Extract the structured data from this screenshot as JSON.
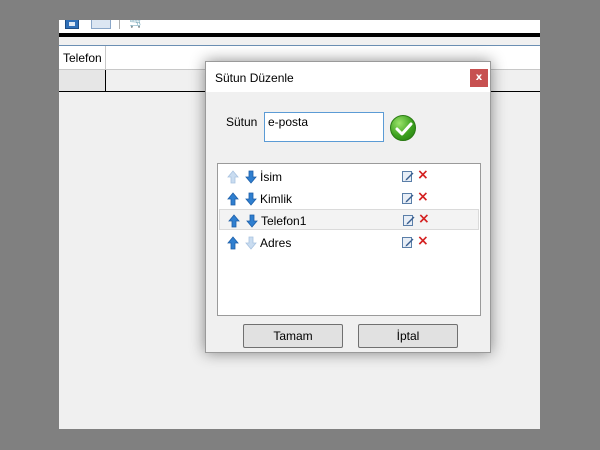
{
  "app": {
    "grid": {
      "columns": [
        "Telefon"
      ]
    }
  },
  "dialog": {
    "title": "Sütun Düzenle",
    "close_label": "x",
    "field_label": "Sütun",
    "field_value": "e-posta",
    "columns": [
      {
        "label": "İsim",
        "up_enabled": false,
        "down_enabled": true
      },
      {
        "label": "Kimlik",
        "up_enabled": true,
        "down_enabled": true
      },
      {
        "label": "Telefon1",
        "up_enabled": true,
        "down_enabled": true,
        "selected": true
      },
      {
        "label": "Adres",
        "up_enabled": true,
        "down_enabled": false
      }
    ],
    "buttons": {
      "ok": "Tamam",
      "cancel": "İptal"
    }
  },
  "colors": {
    "close_bg": "#c75050",
    "input_border": "#5b9bd5",
    "arrow_enabled": "#2f7fd0",
    "arrow_disabled": "#b9cfe6",
    "delete": "#d42020",
    "accept_green": "#3da11f"
  }
}
